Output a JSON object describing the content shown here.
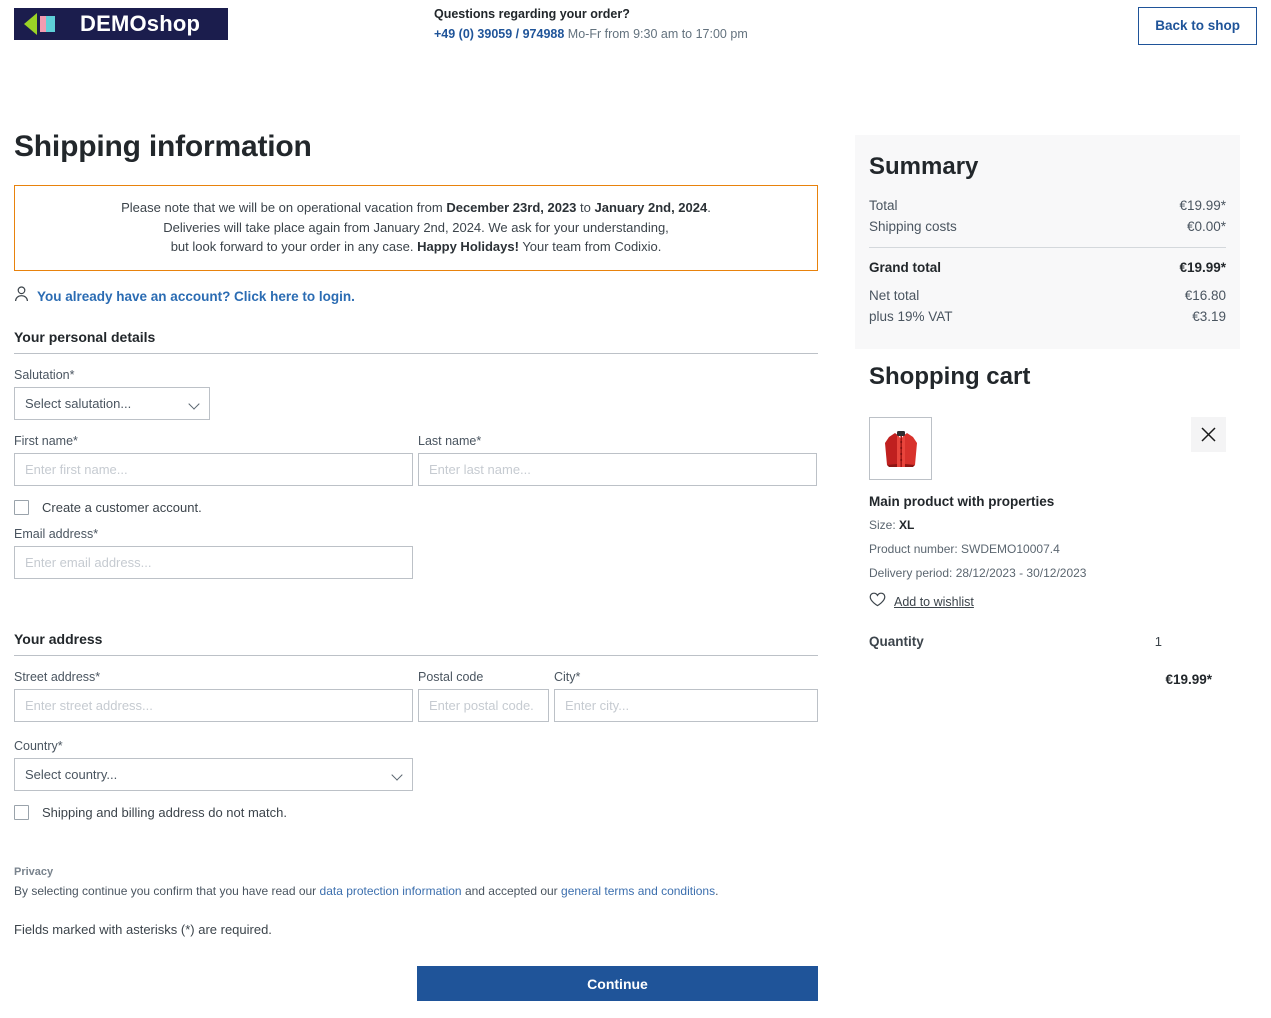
{
  "header": {
    "logo_text": "DEMOshop",
    "contact_title": "Questions regarding your order?",
    "contact_phone": "+49 (0) 39059 / 974988",
    "contact_hours": " Mo-Fr from 9:30 am to 17:00 pm",
    "back_to_shop": "Back to shop"
  },
  "page": {
    "title": "Shipping information"
  },
  "banner": {
    "line1_a": "Please note that we will be on operational vacation from ",
    "line1_b": "December 23rd, 2023",
    "line1_c": " to ",
    "line1_d": "January 2nd, 2024",
    "line1_e": ".",
    "line2": "Deliveries will take place again from January 2nd, 2024. We ask for your understanding,",
    "line3_a": "but look forward to your order in any case. ",
    "line3_b": "Happy Holidays!",
    "line3_c": " Your team from Codixio."
  },
  "login": {
    "link_text": "You already have an account? Click here to login."
  },
  "personal": {
    "section_title": "Your personal details",
    "salutation_label": "Salutation*",
    "salutation_value": "Select salutation...",
    "first_name_label": "First name*",
    "first_name_placeholder": "Enter first name...",
    "first_name_value": "",
    "last_name_label": "Last name*",
    "last_name_placeholder": "Enter last name...",
    "last_name_value": "",
    "create_account_label": "Create a customer account.",
    "email_label": "Email address*",
    "email_placeholder": "Enter email address...",
    "email_value": ""
  },
  "address": {
    "section_title": "Your address",
    "street_label": "Street address*",
    "street_placeholder": "Enter street address...",
    "street_value": "",
    "postal_label": "Postal code",
    "postal_placeholder": "Enter postal code.",
    "postal_value": "",
    "city_label": "City*",
    "city_placeholder": "Enter city...",
    "city_value": "",
    "country_label": "Country*",
    "country_value": "Select country...",
    "mismatch_label": "Shipping and billing address do not match."
  },
  "privacy": {
    "title": "Privacy",
    "text_a": "By selecting continue you confirm that you have read our ",
    "link_data": "data protection information",
    "text_b": " and accepted our ",
    "link_terms": "general terms and conditions",
    "text_c": ".",
    "required_note": "Fields marked with asterisks (*) are required."
  },
  "actions": {
    "continue": "Continue"
  },
  "summary": {
    "title": "Summary",
    "rows": [
      {
        "label": "Total",
        "value": "€19.99*"
      },
      {
        "label": "Shipping costs",
        "value": "€0.00*"
      }
    ],
    "grand_label": "Grand total",
    "grand_value": "€19.99*",
    "net_label": "Net total",
    "net_value": "€16.80",
    "vat_label": "plus 19% VAT",
    "vat_value": "€3.19"
  },
  "cart": {
    "title": "Shopping cart",
    "product_name": "Main product with properties",
    "size_label": "Size: ",
    "size_value": "XL",
    "product_number": "Product number: SWDEMO10007.4",
    "delivery_period": "Delivery period:  28/12/2023  -  30/12/2023",
    "wishlist_label": "Add to wishlist",
    "quantity_label": "Quantity",
    "quantity_value": "1",
    "line_price": "€19.99*"
  },
  "colors": {
    "brand_blue": "#1f5499",
    "link_blue": "#2b6cb3",
    "banner_orange": "#e8820c",
    "logo_navy": "#1b1d4d",
    "logo_green": "#9ad326",
    "summary_bg": "#f8f8f9"
  }
}
